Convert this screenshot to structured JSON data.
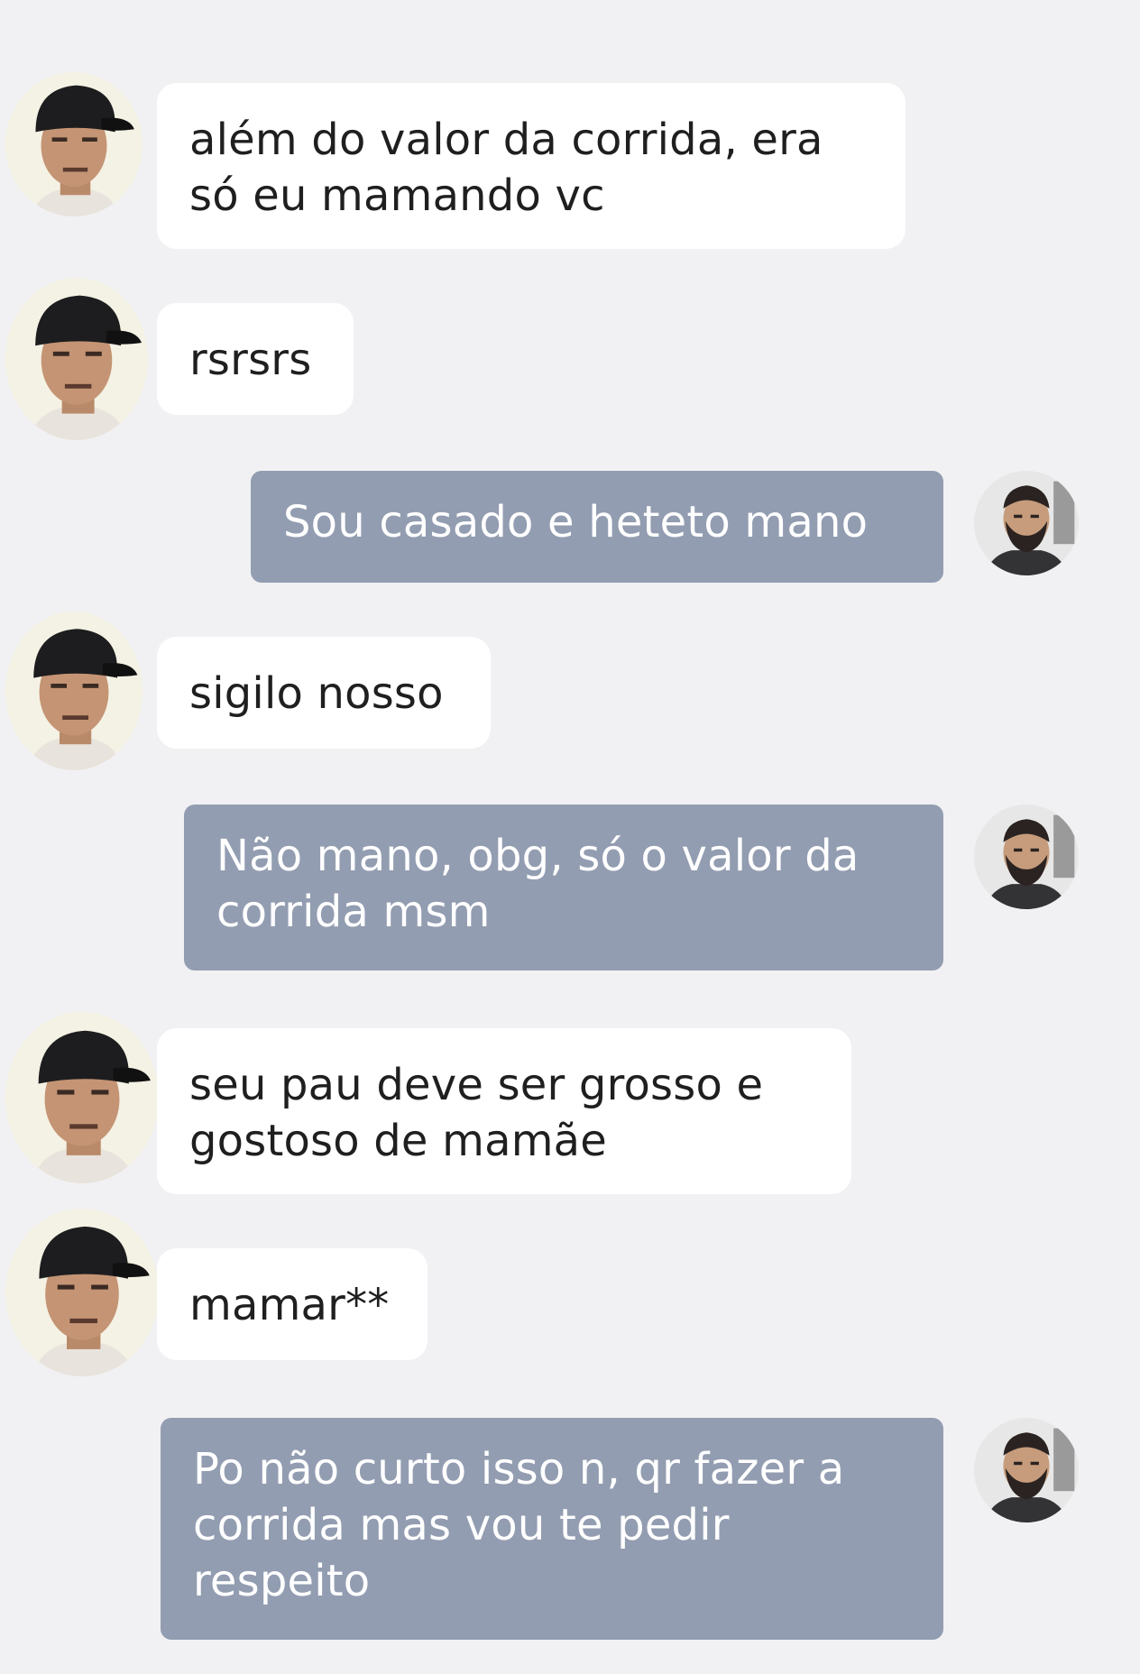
{
  "conversation": {
    "messages": [
      {
        "direction": "incoming",
        "avatar_icon": "contact-avatar-cap",
        "text": "além do valor da corrida, era\nsó eu mamando vc"
      },
      {
        "direction": "incoming",
        "avatar_icon": "contact-avatar-cap",
        "text": "rsrsrs"
      },
      {
        "direction": "outgoing",
        "avatar_icon": "user-avatar-beard",
        "text": "Sou casado e heteto mano"
      },
      {
        "direction": "incoming",
        "avatar_icon": "contact-avatar-cap",
        "text": "sigilo nosso"
      },
      {
        "direction": "outgoing",
        "avatar_icon": "user-avatar-beard",
        "text": "Não mano, obg, só o valor da\ncorrida msm"
      },
      {
        "direction": "incoming",
        "avatar_icon": "contact-avatar-cap",
        "text": "seu pau deve ser grosso e\ngostoso de mamãe"
      },
      {
        "direction": "incoming",
        "avatar_icon": "contact-avatar-cap",
        "text": "mamar**"
      },
      {
        "direction": "outgoing",
        "avatar_icon": "user-avatar-beard",
        "text": "Po não curto isso n, qr fazer a\ncorrida mas vou te pedir\nrespeito"
      }
    ]
  },
  "colors": {
    "background": "#f1f1f3",
    "incoming_bubble": "#ffffff",
    "incoming_text": "#1f1f1f",
    "outgoing_bubble": "#939db1",
    "outgoing_text": "#ffffff"
  }
}
